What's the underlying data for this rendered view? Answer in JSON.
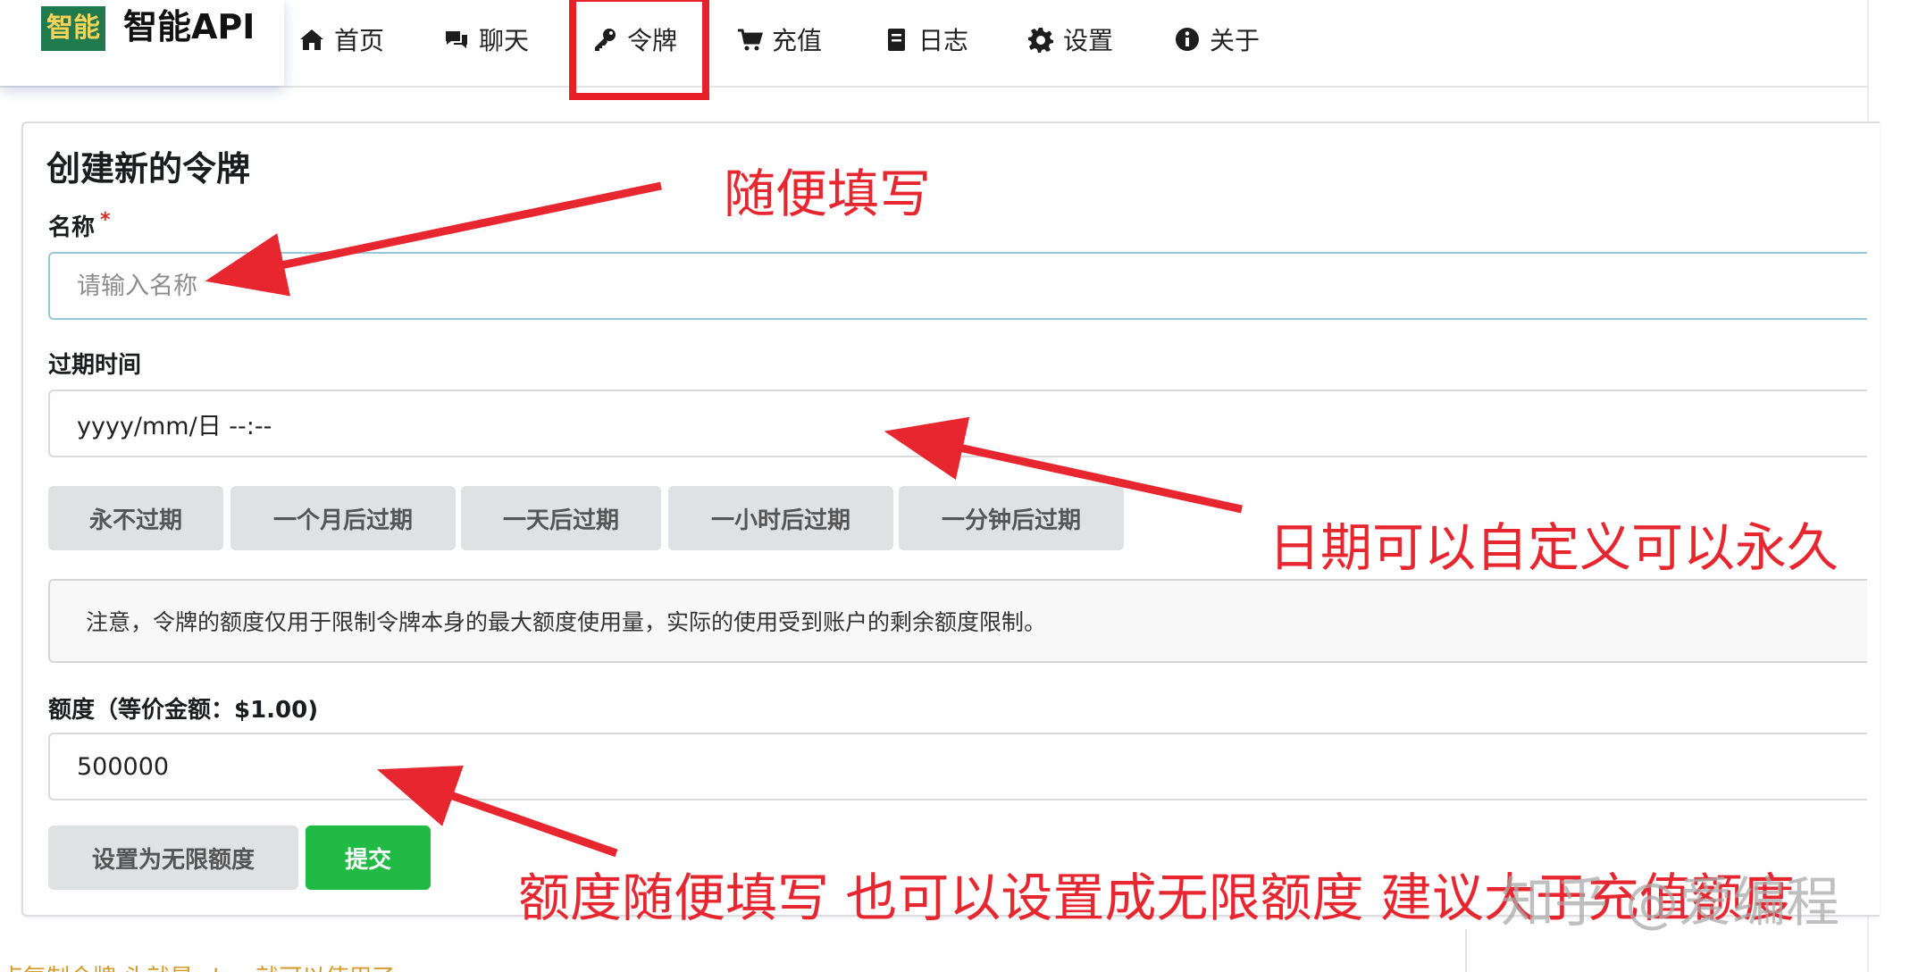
{
  "brand": {
    "logo": "智能",
    "name": "智能API"
  },
  "nav": [
    {
      "label": "首页",
      "icon": "home-icon"
    },
    {
      "label": "聊天",
      "icon": "comments-icon"
    },
    {
      "label": "令牌",
      "icon": "key-icon"
    },
    {
      "label": "充值",
      "icon": "cart-icon"
    },
    {
      "label": "日志",
      "icon": "book-icon"
    },
    {
      "label": "设置",
      "icon": "cog-icon"
    },
    {
      "label": "关于",
      "icon": "info-icon"
    }
  ],
  "form": {
    "title": "创建新的令牌",
    "name_label": "名称",
    "required_mark": "*",
    "name_placeholder": "请输入名称",
    "expiry_label": "过期时间",
    "expiry_placeholder": "yyyy/mm/日 --:--",
    "expiry_buttons": [
      "永不过期",
      "一个月后过期",
      "一天后过期",
      "一小时后过期",
      "一分钟后过期"
    ],
    "notice": "注意，令牌的额度仅用于限制令牌本身的最大额度使用量，实际的使用受到账户的剩余额度限制。",
    "quota_label": "额度（等价金额：$1.00)",
    "quota_value": "500000",
    "unlimited_button": "设置为无限额度",
    "submit_button": "提交"
  },
  "annotations": {
    "name_hint": "随便填写",
    "expiry_hint": "日期可以自定义可以永久",
    "quota_hint": "额度随便填写 也可以设置成无限额度 建议大于充值额度"
  },
  "watermark": "知乎 @爱编程",
  "bottom_text": "点复制令牌 头就是 sk... 就可以使用了",
  "colors": {
    "accent_red": "#e8262f",
    "submit_green": "#21ba45",
    "highlight_red": "#e8202a"
  }
}
